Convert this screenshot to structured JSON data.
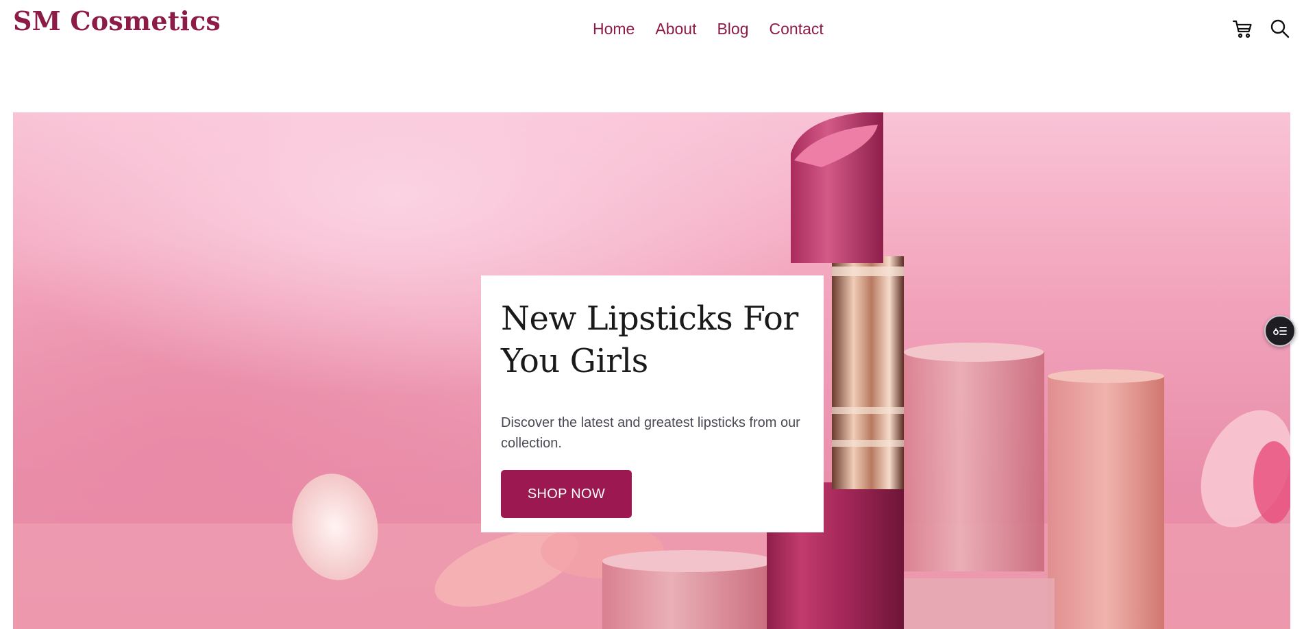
{
  "header": {
    "logo_text": "SM Cosmetics",
    "nav": [
      "Home",
      "About",
      "Blog",
      "Contact"
    ],
    "icons": [
      "cart-icon",
      "search-icon"
    ]
  },
  "hero": {
    "title": "New Lipsticks For You Girls",
    "description": "Discover the latest and greatest lipsticks from our collection.",
    "cta_label": "SHOP NOW"
  },
  "widget": {
    "icon": "settings-list-icon"
  },
  "colors": {
    "brand": "#8d1b47",
    "cta": "#9b1850",
    "hero_pink": "#f2a4bc"
  }
}
